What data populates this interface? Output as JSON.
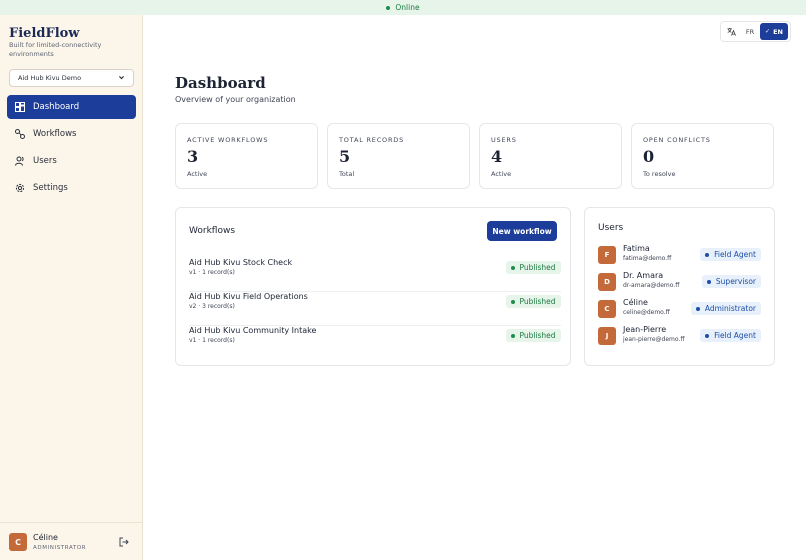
{
  "status_bar": {
    "text": "Online"
  },
  "sidebar": {
    "brand": "FieldFlow",
    "tagline": "Built for limited-connectivity environments",
    "org_select": "Aid Hub Kivu Demo",
    "nav": [
      {
        "label": "Dashboard",
        "icon": "dashboard-icon",
        "active": true
      },
      {
        "label": "Workflows",
        "icon": "workflow-icon",
        "active": false
      },
      {
        "label": "Users",
        "icon": "users-icon",
        "active": false
      },
      {
        "label": "Settings",
        "icon": "gear-icon",
        "active": false
      }
    ],
    "current_user": {
      "initial": "C",
      "name": "Céline",
      "role": "ADMINISTRATOR"
    }
  },
  "lang": {
    "fr": "FR",
    "en": "EN",
    "active": "EN"
  },
  "header": {
    "title": "Dashboard",
    "subtitle": "Overview of your organization"
  },
  "stats": [
    {
      "label": "ACTIVE WORKFLOWS",
      "value": "3",
      "sub": "Active"
    },
    {
      "label": "TOTAL RECORDS",
      "value": "5",
      "sub": "Total"
    },
    {
      "label": "USERS",
      "value": "4",
      "sub": "Active"
    },
    {
      "label": "OPEN CONFLICTS",
      "value": "0",
      "sub": "To resolve"
    }
  ],
  "workflows": {
    "title": "Workflows",
    "new_button": "New workflow",
    "items": [
      {
        "name": "Aid Hub Kivu Stock Check",
        "meta": "v1 · 1 record(s)",
        "status": "Published"
      },
      {
        "name": "Aid Hub Kivu Field Operations",
        "meta": "v2 · 3 record(s)",
        "status": "Published"
      },
      {
        "name": "Aid Hub Kivu Community Intake",
        "meta": "v1 · 1 record(s)",
        "status": "Published"
      }
    ]
  },
  "users": {
    "title": "Users",
    "items": [
      {
        "initial": "F",
        "name": "Fatima",
        "email": "fatima@demo.ff",
        "role": "Field Agent"
      },
      {
        "initial": "D",
        "name": "Dr. Amara",
        "email": "dr-amara@demo.ff",
        "role": "Supervisor"
      },
      {
        "initial": "C",
        "name": "Céline",
        "email": "celine@demo.ff",
        "role": "Administrator"
      },
      {
        "initial": "J",
        "name": "Jean-Pierre",
        "email": "jean-pierre@demo.ff",
        "role": "Field Agent"
      }
    ]
  },
  "colors": {
    "primary": "#1c3d99",
    "success": "#1e8e4a",
    "avatar": "#c46a3a",
    "sidebar_bg": "#fcf6ea"
  }
}
